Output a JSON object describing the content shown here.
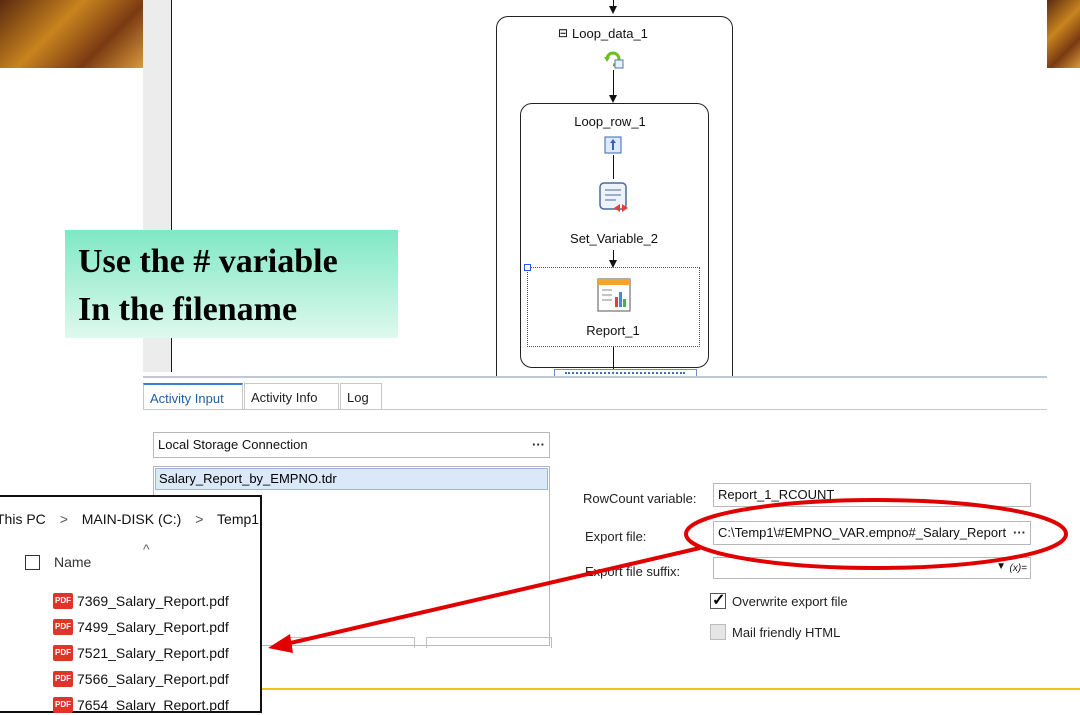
{
  "workflow": {
    "loop_data_label": "Loop_data_1",
    "collapse_glyph": "⊟",
    "loop_row_label": "Loop_row_1",
    "set_variable_label": "Set_Variable_2",
    "report_label": "Report_1"
  },
  "tabs": [
    {
      "label": "Activity Input"
    },
    {
      "label": "Activity Info"
    },
    {
      "label": "Log"
    }
  ],
  "form": {
    "connection_value": "Local Storage Connection",
    "file_item": "Salary_Report_by_EMPNO.tdr",
    "rowcount_label": "RowCount variable:",
    "rowcount_value": "Report_1_RCOUNT",
    "export_file_label": "Export file:",
    "export_file_value": "C:\\Temp1\\#EMPNO_VAR.empno#_Salary_Report",
    "export_suffix_label": "Export file suffix:",
    "export_suffix_value": "",
    "overwrite_label": "Overwrite export file",
    "overwrite_checked": true,
    "mail_label": "Mail friendly HTML",
    "mail_checked": false,
    "dots": "···",
    "fx": "(x)="
  },
  "callout": {
    "line1": "Use the # variable",
    "line2": "In the filename"
  },
  "explorer": {
    "crumb_this_pc": "This PC",
    "crumb_sep": ">",
    "crumb_disk": "MAIN-DISK (C:)",
    "crumb_folder": "Temp1",
    "column_name": "Name",
    "sort_glyph": "^",
    "pdf_badge": "PDF",
    "files": [
      "7369_Salary_Report.pdf",
      "7499_Salary_Report.pdf",
      "7521_Salary_Report.pdf",
      "7566_Salary_Report.pdf",
      "7654_Salary_Report.pdf"
    ]
  },
  "colors": {
    "annotation_red": "#e00000",
    "callout_green": "#7fe8c4",
    "accent_blue": "#3b7dd8"
  }
}
